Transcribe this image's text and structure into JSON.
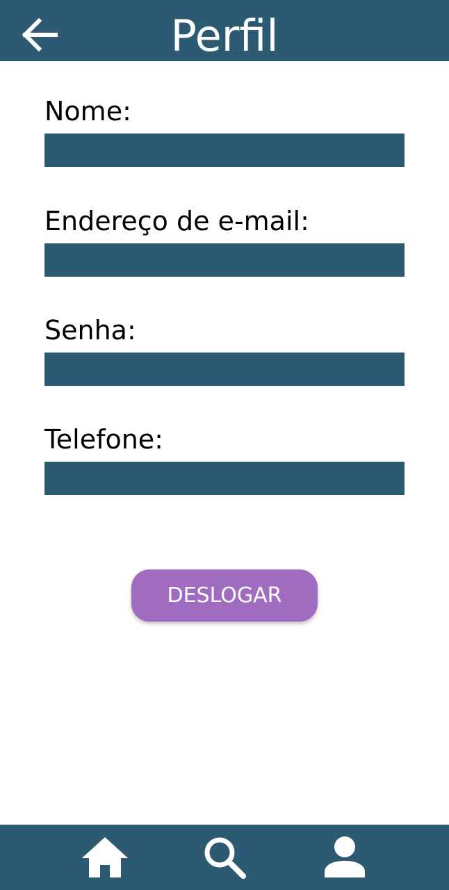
{
  "header": {
    "title": "Perfil",
    "back_icon": "arrow-left-icon"
  },
  "form": {
    "fields": [
      {
        "label": "Nome:",
        "value": ""
      },
      {
        "label": "Endereço de e-mail:",
        "value": ""
      },
      {
        "label": "Senha:",
        "value": ""
      },
      {
        "label": "Telefone:",
        "value": ""
      }
    ]
  },
  "logout_button": {
    "label": "DESLOGAR"
  },
  "bottom_nav": {
    "items": [
      {
        "icon": "home-icon"
      },
      {
        "icon": "search-icon"
      },
      {
        "icon": "person-icon"
      }
    ]
  },
  "colors": {
    "primary": "#2b5a72",
    "button": "#a06cc0",
    "background": "#ffffff",
    "text": "#000000"
  }
}
